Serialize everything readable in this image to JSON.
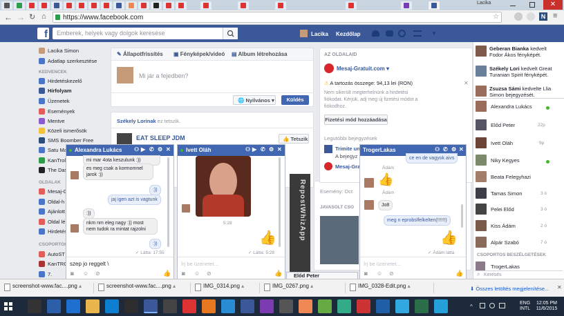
{
  "browser": {
    "url": "https://www.facebook.com",
    "window_title": "Lacika",
    "tab_count": 20
  },
  "header": {
    "search_placeholder": "Emberek, helyek vagy dolgok keresése",
    "user": "Lacika",
    "home": "Kezdőlap"
  },
  "left_nav": {
    "profile": "Lacika Simon",
    "edit": "Adatlap szerkesztése",
    "favorites_head": "KEDVENCEK",
    "items": [
      "Hirdetéskezelő",
      "Hírfolyam",
      "Üzenetek",
      "Események",
      "Mentve",
      "Közeli ismerősök",
      "SMS Boomber Free",
      "Satu Ma",
      "KanTroll",
      "The Das"
    ],
    "pages_head": "OLDALAK",
    "pages": [
      "Mesaj-G",
      "Oldal-h",
      "Ajánlott",
      "Oldal lé",
      "Hirdetés"
    ],
    "groups_head": "CSOPORTOK",
    "groups": [
      "AutoST",
      "KanTRO",
      "7."
    ]
  },
  "composer": {
    "tab_status": "Állapotfrissítés",
    "tab_photo": "Fényképek/videó",
    "tab_album": "Album létrehozása",
    "placeholder": "Mi jár a fejedben?",
    "privacy": "Nyilvános",
    "post": "Küldés"
  },
  "feed": {
    "liker": "Székely Lorinak",
    "liked_text": " ez tetszik.",
    "page_name": "EAT SLEEP JDM",
    "like_btn": "Tetszik",
    "eloed_peter": "Előd Peter",
    "events_label": "Esemény: Oct",
    "suggest_label": "JAVASOLT CSO",
    "watermark": "RepostWhizApp"
  },
  "ads": {
    "head": "AZ OLDALAID",
    "page": "Mesaj-Gratuit.com",
    "warning": "A tartozás összege: 94,13 lei (RON)",
    "warning_body": "Nem sikerült megterhelnünk a hirdetési fiókodat. Kérjük, adj meg új fizetési módot a fiókodhoz.",
    "add_payment": "Fizetési mód hozzáadása",
    "recent_head": "Legutóbbi bejegyzések",
    "recent1": "Trimite un",
    "recent2": "A bejegyz",
    "recent3": "Mesaj-Grat"
  },
  "chat1": {
    "name": "Alexandra Lukács",
    "messages": [
      {
        "from": "her",
        "text": "mi mar 4ota keszulunk :))"
      },
      {
        "from": "her",
        "text": "es meg csak a kormomnel jarok :))"
      },
      {
        "from": "me",
        "text": ":))"
      },
      {
        "from": "me",
        "text": "jaj igen azt is vagtunk"
      },
      {
        "from": "her",
        "text": ":))"
      },
      {
        "from": "her",
        "text": "nkm nm eleg nagy :)) most nem tudok ra mintat rajzolni"
      },
      {
        "from": "me",
        "text": ":))"
      }
    ],
    "seen": "✓ Látta: 17:55",
    "input": "szep jo reggelt \\"
  },
  "chat2": {
    "name": "Ivett Oláh",
    "time": "5:28",
    "seen": "✓ Látta: 5:28",
    "input_placeholder": "Írj be üzenetet..."
  },
  "chat3": {
    "name": "TrogerLakas",
    "messages": [
      {
        "from": "her",
        "text": "ce en de vagyok aivs"
      },
      {
        "from": "label",
        "text": "Ádám"
      },
      {
        "from": "label",
        "text": "Ádám"
      },
      {
        "from": "her",
        "text": "Jo8"
      },
      {
        "from": "me",
        "text": "meg n eprobslfelkelten(!!!!!!)"
      }
    ],
    "seen": "✓ Ádám látta",
    "input_placeholder": "Írj be üzenetet..."
  },
  "ticker": [
    {
      "name": "Geberan Bianka",
      "text": " kedvelt Fodor Ákos fényképét."
    },
    {
      "name": "Székely Lori",
      "text": " kedvelt Great Turanian Spirit fényképét."
    },
    {
      "name": "Zsuzsa Sámi",
      "text": " kedvelte Llia Simon bejegyzését."
    }
  ],
  "contacts": [
    {
      "name": "Alexandra Lukács",
      "status": "online"
    },
    {
      "name": "Előd Peter",
      "status": "22p"
    },
    {
      "name": "Ivett Oláh",
      "status": "9p"
    },
    {
      "name": "Niky Kegyes",
      "status": "online"
    },
    {
      "name": "Beata Felegyhazi",
      "status": ""
    },
    {
      "name": "Tamas Simon",
      "status": "3 ó"
    },
    {
      "name": "Pelei Előd",
      "status": "3 ó"
    },
    {
      "name": "Kiss Ádám",
      "status": "2 ó"
    },
    {
      "name": "Alpár Szabó",
      "status": "7 ó"
    }
  ],
  "contacts_groups_head": "CSOPORTOS BESZÉLGETÉSEK",
  "contacts_group": "TrogerLakas",
  "sidebar_search": "Keresés",
  "downloads": {
    "items": [
      "screenshot-www.fac....png",
      "screenshot-www.fac....png",
      "IMG_0314.png",
      "IMG_0267.png",
      "IMG_0328-Edit.png"
    ],
    "show_all": "Összes letöltés megjelenítése..."
  },
  "taskbar": {
    "lang": "ENG",
    "layout": "INTL",
    "time": "12:05 PM",
    "date": "11/6/2015"
  },
  "colors": {
    "fb_blue": "#3b5998",
    "chat_head": "#4267b2"
  }
}
